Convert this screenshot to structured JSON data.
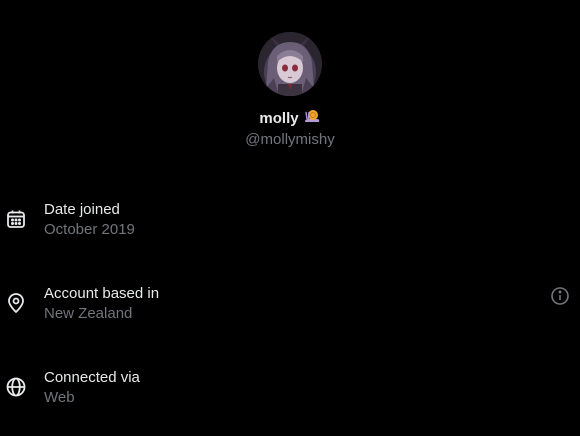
{
  "profile": {
    "display_name": "molly",
    "name_emoji": "snail-emoji",
    "handle": "@mollymishy",
    "avatar": "avatar-image"
  },
  "rows": [
    {
      "title": "Date joined",
      "value": "October 2019",
      "icon": "calendar-icon"
    },
    {
      "title": "Account based in",
      "value": "New Zealand",
      "icon": "location-pin-icon",
      "action_icon": "info-icon"
    },
    {
      "title": "Connected via",
      "value": "Web",
      "icon": "globe-icon"
    }
  ],
  "colors": {
    "background": "#000000",
    "primary_text": "#e7e9ea",
    "secondary_text": "#71767b"
  }
}
